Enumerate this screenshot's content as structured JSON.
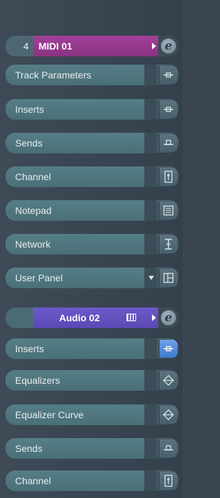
{
  "track1": {
    "number": "4",
    "name": "MIDI 01",
    "color": "#9a3a90",
    "edit_label": "e",
    "sections": [
      {
        "label": "Track Parameters",
        "icon": "track-parameters-icon"
      },
      {
        "label": "Inserts",
        "icon": "inserts-icon"
      },
      {
        "label": "Sends",
        "icon": "sends-icon"
      },
      {
        "label": "Channel",
        "icon": "channel-icon"
      },
      {
        "label": "Notepad",
        "icon": "notepad-icon"
      },
      {
        "label": "Network",
        "icon": "network-icon"
      },
      {
        "label": "User Panel",
        "icon": "user-panel-icon"
      }
    ]
  },
  "track2": {
    "number": "",
    "name": "Audio 02",
    "color": "#6352c0",
    "edit_label": "e",
    "sections": [
      {
        "label": "Inserts",
        "icon": "inserts-icon",
        "active": true
      },
      {
        "label": "Equalizers",
        "icon": "equalizers-icon"
      },
      {
        "label": "Equalizer Curve",
        "icon": "equalizer-curve-icon"
      },
      {
        "label": "Sends",
        "icon": "sends-icon"
      },
      {
        "label": "Channel",
        "icon": "channel-icon"
      }
    ]
  }
}
